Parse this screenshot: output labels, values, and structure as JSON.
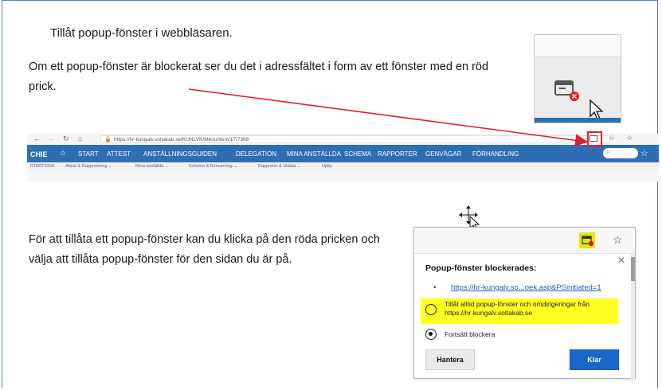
{
  "document": {
    "title": "Tillåt popup-fönster i webbläsaren.",
    "para1": "Om ett popup-fönster är blockerat ser du det i adressfältet i form av ett fönster med en röd prick.",
    "para2": "För att tillåta ett popup-fönster kan du klicka på den röda pricken och välja att tillåta popup-fönster för den sidan du är på."
  },
  "browser": {
    "url": "https://hr-kungalv.soltakab.se/KUNLVK/Menu/Item/17/7368",
    "logo": "CHIE",
    "nav_items": [
      "START",
      "ATTEST",
      "ANSTÄLLNINGSGUIDEN",
      "DELEGATION",
      "MINA ANSTÄLLDA",
      "SCHEMA",
      "RAPPORTER",
      "GENVÄGAR",
      "FÖRHANDLING"
    ],
    "sub_items": [
      "STARTSIDA",
      "Attest & Rapportering ⌄",
      "Mina anställda ⌄",
      "Schema & Bemanning ⌄",
      "Rapporter & Utdata ⌄",
      "Hjälp"
    ]
  },
  "popup_dialog": {
    "heading": "Popup-fönster blockerades:",
    "bullet": "•",
    "link": "https://hr-kungalv.so...oek.asp&PSinitiated=1",
    "option_allow": "Tillåt alltid popup-fönster och omdirigeringar från https://hr-kungalv.soltakab.se",
    "option_block": "Fortsätt blockera",
    "manage_button": "Hantera",
    "done_button": "Klar"
  },
  "colors": {
    "nav_blue": "#2e6eb5",
    "highlight": "#ffff22",
    "arrow_red": "#e02020",
    "primary_button": "#1a66c9"
  },
  "icons": [
    "back-icon",
    "forward-icon",
    "refresh-icon",
    "home-icon",
    "lock-icon",
    "popup-blocked-icon",
    "star-icon",
    "search-icon",
    "cursor-icon",
    "move-cursor-icon",
    "close-icon"
  ]
}
